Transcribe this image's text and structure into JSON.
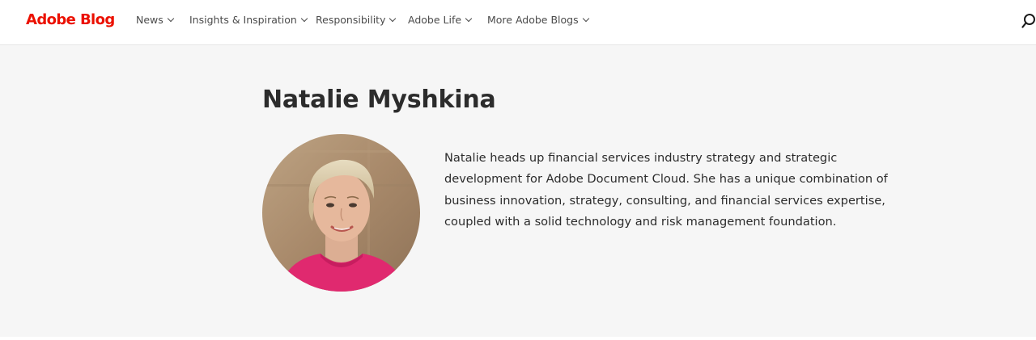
{
  "header": {
    "logo_text": "Adobe Blog",
    "brand_color": "#eb1000",
    "nav": [
      {
        "label": "News"
      },
      {
        "label": "Insights & Inspiration"
      },
      {
        "label": "Responsibility"
      },
      {
        "label": "Adobe Life"
      },
      {
        "label": "More Adobe Blogs"
      }
    ],
    "search_icon": "search-icon"
  },
  "author": {
    "name": "Natalie Myshkina",
    "photo_icon": "author-avatar",
    "bio": "Natalie heads up financial services industry strategy and strategic development for Adobe Document Cloud. She has a unique combination of business innovation, strategy, consulting, and financial services expertise, coupled with a solid technology and risk management foundation."
  },
  "colors": {
    "hero_background": "#f6f6f6",
    "text": "#2c2c2c"
  }
}
